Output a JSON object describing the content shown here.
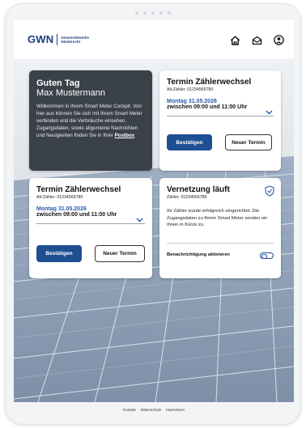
{
  "header": {
    "logo_main": "GWN",
    "logo_sub_line1": "Gemeindewerke",
    "logo_sub_line2": "Nümbrecht",
    "icons": [
      "home-icon",
      "inbox-icon",
      "user-icon"
    ]
  },
  "greeting": {
    "line1": "Guten Tag",
    "line2": "Max Mustermann",
    "body": "Willkommen in Ihrem Smart Meter Cockpit. Von hier aus können Sie sich mit Ihrem Smart Meter verbinden und die Verbräuche einsehen. Zugangsdaten, sowie allgemeine Nachrichten und Neuigkeiten finden Sie in Ihrer",
    "link": "Postbox"
  },
  "appointment_top": {
    "title": "Termin Zählerwechsel",
    "meter": "Alt-Zähler: 01234566789",
    "date": "Montag 31.05.2026",
    "time": "zwischen 09:00 und 11:00 Uhr",
    "confirm_label": "Bestätigen",
    "new_label": "Neuer Termin"
  },
  "appointment_mid": {
    "title": "Termin Zählerwechsel",
    "meter": "Alt-Zähler: 01234566789",
    "date": "Montag 31.05.2026",
    "time": "zwischen 09:00 und 11:00 Uhr",
    "confirm_label": "Bestätigen",
    "new_label": "Neuer Termin"
  },
  "networking": {
    "title": "Vernetzung läuft",
    "meter": "Zähler: 01234566789",
    "body": "Ihr Zähler wurde erfolgreich eingerichtet. Die Zugangsdaten zu Ihrem Smart Meter senden wir Ihnen in Kürze zu.",
    "notify_label": "Benachrichtigung aktivieren",
    "notify_enabled": false
  },
  "footer": {
    "links": [
      "Kontakt",
      "Datenschutz",
      "Impressum"
    ]
  },
  "colors": {
    "brand": "#1b3f7a",
    "primary_button": "#1f4f93",
    "dark_card": "#3a4149",
    "accent_blue": "#2a5aa8"
  }
}
